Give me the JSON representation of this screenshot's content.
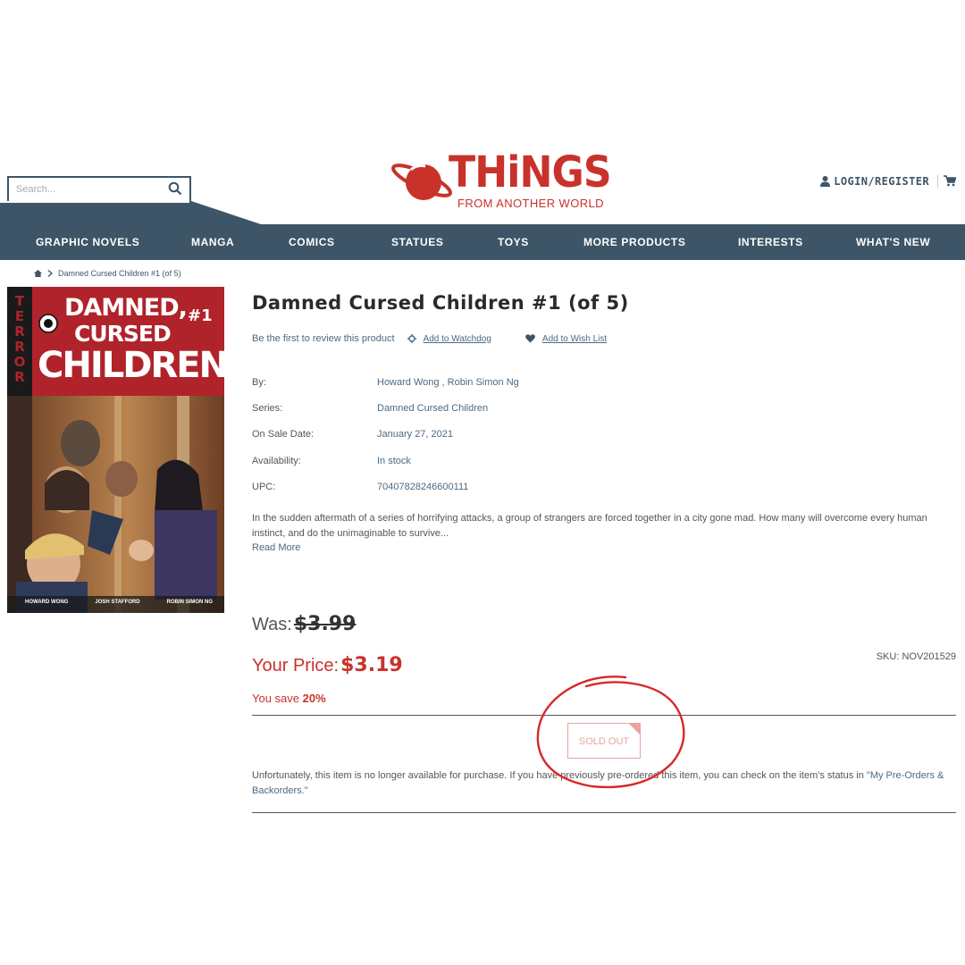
{
  "header": {
    "search_placeholder": "Search...",
    "logo_title": "THiNGS",
    "logo_subtitle": "FROM ANOTHER WORLD",
    "account_label": "LOGIN/REGISTER"
  },
  "nav": {
    "items": [
      "GRAPHIC NOVELS",
      "MANGA",
      "COMICS",
      "STATUES",
      "TOYS",
      "MORE PRODUCTS",
      "INTERESTS",
      "WHAT'S NEW"
    ]
  },
  "breadcrumb": {
    "current": "Damned Cursed Children #1 (of 5)"
  },
  "cover": {
    "vertical_label": "TERROR",
    "title_line1": "DAMNED,",
    "title_issue": "#1",
    "title_line2": "CURSED",
    "title_line3": "CHILDREN",
    "credits": [
      "HOWARD WONG",
      "JOSH STAFFORD",
      "ROBIN SIMON NG"
    ]
  },
  "product": {
    "title": "Damned Cursed Children #1 (of 5)",
    "review_text": "Be the first to review this product",
    "watchdog_label": "Add to Watchdog",
    "wishlist_label": "Add to Wish List",
    "details": [
      {
        "label": "By:",
        "value": "Howard Wong ,  Robin Simon  Ng"
      },
      {
        "label": "Series:",
        "value": "Damned Cursed Children"
      },
      {
        "label": "On Sale Date:",
        "value": "January 27, 2021"
      },
      {
        "label": "Availability:",
        "value": "In stock"
      },
      {
        "label": "UPC:",
        "value": "70407828246600111"
      }
    ],
    "description": "In the sudden aftermath of a series of horrifying attacks, a group of strangers are forced together in a city gone mad.  How many will overcome every human instinct, and do the unimaginable to survive...",
    "read_more": "Read  More",
    "was_label": "Was:",
    "was_price": "$3.99",
    "your_price_label": "Your  Price:",
    "your_price": "$3.19",
    "save_label": "You save",
    "save_percent": "20%",
    "sku": "SKU:  NOV201529",
    "sold_out_label": "SOLD OUT",
    "unavailable_text": "Unfortunately, this item is no longer available for purchase.  If you have previously pre-ordered this item, you can check on the item's status in ",
    "preorders_link": "\"My  Pre-Orders & Backorders.\""
  },
  "colors": {
    "brand_red": "#c8322b",
    "nav_blue": "#3d5566",
    "link_blue": "#4a6a84"
  }
}
